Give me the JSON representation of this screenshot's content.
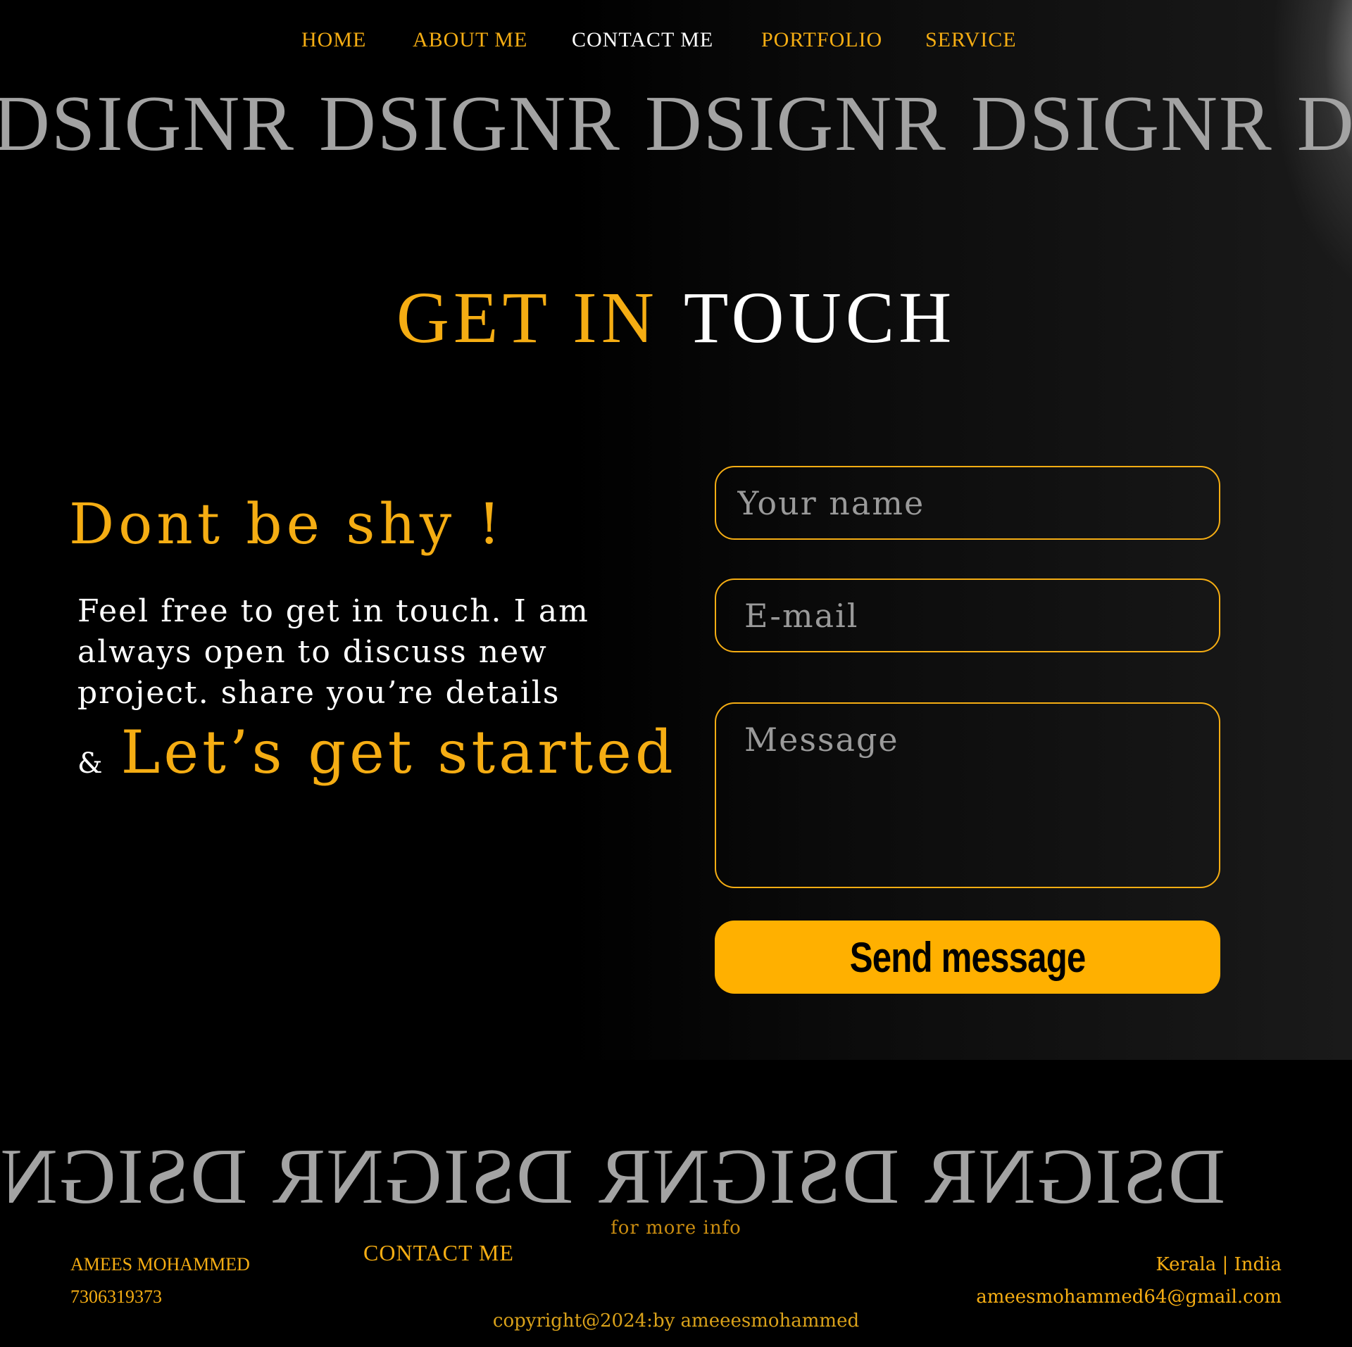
{
  "nav": {
    "items": [
      {
        "label": "HOME"
      },
      {
        "label": "ABOUT ME"
      },
      {
        "label": "CONTACT ME"
      },
      {
        "label": "PORTFOLIO"
      },
      {
        "label": "SERVICE"
      }
    ],
    "active": "CONTACT ME"
  },
  "marquee": {
    "word": "DSIGNR"
  },
  "hero": {
    "title_part1": "GET IN",
    "title_part2": "TOUCH",
    "heading": "Dont be shy !",
    "intro": "Feel free to get in touch. I am always open to discuss new project. share you’re details",
    "ampersand": "&",
    "tagline": "Let’s get started"
  },
  "form": {
    "name_placeholder": "Your name",
    "email_placeholder": "E-mail",
    "message_placeholder": "Message",
    "submit_label": "Send message"
  },
  "footer": {
    "more_info": "for more info",
    "owner_name": "AMEES MOHAMMED",
    "phone": "7306319373",
    "contact_label": "CONTACT ME",
    "location": "Kerala | India",
    "email": "ameesmohammed64@gmail.com",
    "copyright": "copyright@2024:by ameeesmohammed"
  },
  "colors": {
    "accent": "#f5ad13",
    "button": "#ffb000",
    "background": "#000000",
    "marquee_text": "#a3a3a3"
  }
}
